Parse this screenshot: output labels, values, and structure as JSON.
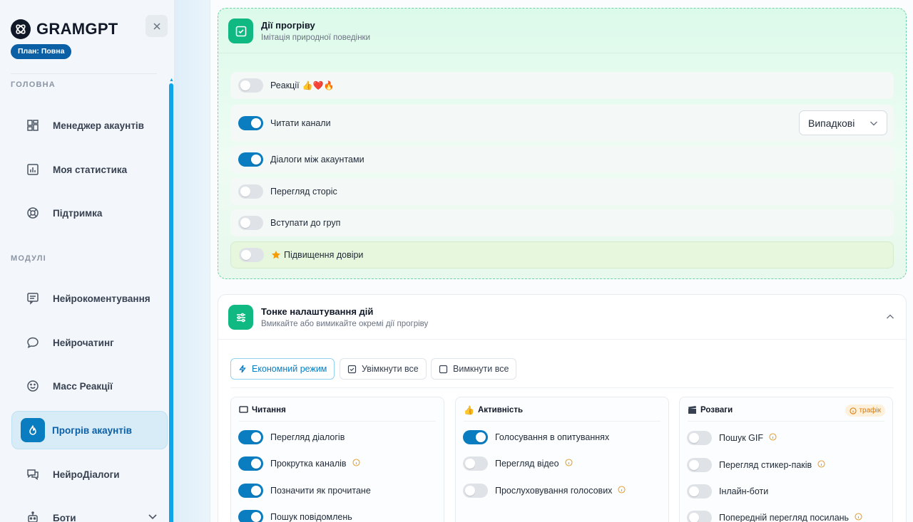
{
  "sidebar": {
    "brand": "GRAMGPT",
    "plan": "План: Повна",
    "sections": {
      "main": "ГОЛОВНА",
      "modules": "МОДУЛІ"
    },
    "items": [
      {
        "label": "Менеджер акаунтів"
      },
      {
        "label": "Моя статистика"
      },
      {
        "label": "Підтримка"
      },
      {
        "label": "Нейрокоментування"
      },
      {
        "label": "Нейрочатинг"
      },
      {
        "label": "Масс Реакції"
      },
      {
        "label": "Прогрів акаунтів"
      },
      {
        "label": "НейроДіалоги"
      },
      {
        "label": "Боти"
      }
    ],
    "active": "Прогрів акаунтів"
  },
  "warmup": {
    "title": "Дії прогріву",
    "subtitle": "Імітація природної поведінки",
    "rows": [
      {
        "label": "Реакції",
        "emoji": "👍❤️🔥",
        "on": false
      },
      {
        "label": "Читати канали",
        "on": true
      },
      {
        "label": "Діалоги між акаунтами",
        "on": true
      },
      {
        "label": "Перегляд сторіс",
        "on": false
      },
      {
        "label": "Вступати до груп",
        "on": false
      },
      {
        "label": "Підвищення довіри",
        "on": false
      }
    ],
    "read_mode": "Випадкові"
  },
  "fine": {
    "title": "Тонке налаштування дій",
    "subtitle": "Вмикайте або вимикайте окремі дії прогріву",
    "buttons": {
      "eco": "Економний режим",
      "enable_all": "Увімкнути все",
      "disable_all": "Вимкнути все"
    },
    "columns": [
      {
        "title": "Читання",
        "items": [
          {
            "label": "Перегляд діалогів",
            "on": true,
            "info": false
          },
          {
            "label": "Прокрутка каналів",
            "on": true,
            "info": true
          },
          {
            "label": "Позначити як прочитане",
            "on": true,
            "info": false
          },
          {
            "label": "Пошук повідомлень",
            "on": true,
            "info": false
          }
        ]
      },
      {
        "title": "Активність",
        "items": [
          {
            "label": "Голосування в опитуваннях",
            "on": true,
            "info": false
          },
          {
            "label": "Перегляд відео",
            "on": false,
            "info": true
          },
          {
            "label": "Прослуховування голосових",
            "on": false,
            "info": true
          }
        ]
      },
      {
        "title": "Розваги",
        "badge": "трафік",
        "items": [
          {
            "label": "Пошук GIF",
            "on": false,
            "info": true
          },
          {
            "label": "Перегляд стикер-паків",
            "on": false,
            "info": true
          },
          {
            "label": "Інлайн-боти",
            "on": false,
            "info": false
          },
          {
            "label": "Попередній перегляд посилань",
            "on": false,
            "info": true
          }
        ]
      }
    ]
  },
  "colors": {
    "accent": "#0a7cc0",
    "green": "#10b981",
    "warning": "#e5a33a"
  }
}
